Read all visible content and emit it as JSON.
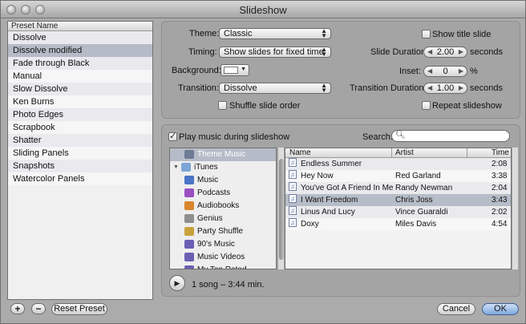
{
  "window": {
    "title": "Slideshow"
  },
  "presets": {
    "header": "Preset Name",
    "items": [
      {
        "label": "Dissolve",
        "selected": false
      },
      {
        "label": "Dissolve modified",
        "selected": true
      },
      {
        "label": "Fade through Black",
        "selected": false
      },
      {
        "label": "Manual",
        "selected": false
      },
      {
        "label": "Slow Dissolve",
        "selected": false
      },
      {
        "label": "Ken Burns",
        "selected": false
      },
      {
        "label": "Photo Edges",
        "selected": false
      },
      {
        "label": "Scrapbook",
        "selected": false
      },
      {
        "label": "Shatter",
        "selected": false
      },
      {
        "label": "Sliding Panels",
        "selected": false
      },
      {
        "label": "Snapshots",
        "selected": false
      },
      {
        "label": "Watercolor Panels",
        "selected": false
      }
    ],
    "add_label": "+",
    "remove_label": "−",
    "reset_label": "Reset Preset"
  },
  "settings": {
    "theme_label": "Theme:",
    "theme_value": "Classic",
    "timing_label": "Timing:",
    "timing_value": "Show slides for fixed time",
    "background_label": "Background:",
    "transition_label": "Transition:",
    "transition_value": "Dissolve",
    "shuffle_label": "Shuffle slide order",
    "shuffle_checked": false,
    "show_title_label": "Show title slide",
    "show_title_checked": false,
    "slide_duration_label": "Slide Duration",
    "slide_duration_value": "2.00",
    "slide_duration_unit": "seconds",
    "inset_label": "Inset:",
    "inset_value": "0",
    "inset_unit": "%",
    "transition_duration_label": "Transition Duration:",
    "transition_duration_value": "1.00",
    "transition_duration_unit": "seconds",
    "repeat_label": "Repeat slideshow",
    "repeat_checked": false,
    "background_color": "#ffffff"
  },
  "music": {
    "play_music_label": "Play music during slideshow",
    "play_music_checked": true,
    "search_label": "Search:",
    "search_value": "",
    "sources": [
      {
        "label": "Theme Music",
        "icon": "film-icon",
        "color": "#6d7b94",
        "selected": true
      },
      {
        "label": "iTunes",
        "icon": "itunes-icon",
        "color": "#7da6d6",
        "disclosure": "▼",
        "selected": false
      },
      {
        "label": "Music",
        "icon": "music-note-icon",
        "color": "#4a74c5",
        "selected": false
      },
      {
        "label": "Podcasts",
        "icon": "podcast-icon",
        "color": "#9a4fc1",
        "selected": false
      },
      {
        "label": "Audiobooks",
        "icon": "audiobook-icon",
        "color": "#d9862c",
        "selected": false
      },
      {
        "label": "Genius",
        "icon": "genius-icon",
        "color": "#8f8f8f",
        "selected": false
      },
      {
        "label": "Party Shuffle",
        "icon": "party-shuffle-icon",
        "color": "#c9a13c",
        "selected": false
      },
      {
        "label": "90's Music",
        "icon": "smart-playlist-icon",
        "color": "#6a5fb3",
        "selected": false
      },
      {
        "label": "Music Videos",
        "icon": "smart-playlist-icon",
        "color": "#6a5fb3",
        "selected": false
      },
      {
        "label": "My Top Rated",
        "icon": "smart-playlist-icon",
        "color": "#6a5fb3",
        "selected": false
      }
    ],
    "columns": {
      "name": "Name",
      "artist": "Artist",
      "time": "Time"
    },
    "tracks": [
      {
        "name": "Endless Summer",
        "artist": "",
        "time": "2:08",
        "selected": false
      },
      {
        "name": "Hey Now",
        "artist": "Red Garland",
        "time": "3:38",
        "selected": false
      },
      {
        "name": "You've Got A Friend In Me",
        "artist": "Randy Newman",
        "time": "2:04",
        "selected": false
      },
      {
        "name": "I Want Freedom",
        "artist": "Chris Joss",
        "time": "3:43",
        "selected": true
      },
      {
        "name": "Linus And Lucy",
        "artist": "Vince Guaraldi",
        "time": "2:02",
        "selected": false
      },
      {
        "name": "Doxy",
        "artist": "Miles Davis",
        "time": "4:54",
        "selected": false
      }
    ],
    "summary": "1 song – 3:44 min."
  },
  "footer": {
    "cancel_label": "Cancel",
    "ok_label": "OK"
  },
  "accent_selection_color": "#b6bcc7"
}
